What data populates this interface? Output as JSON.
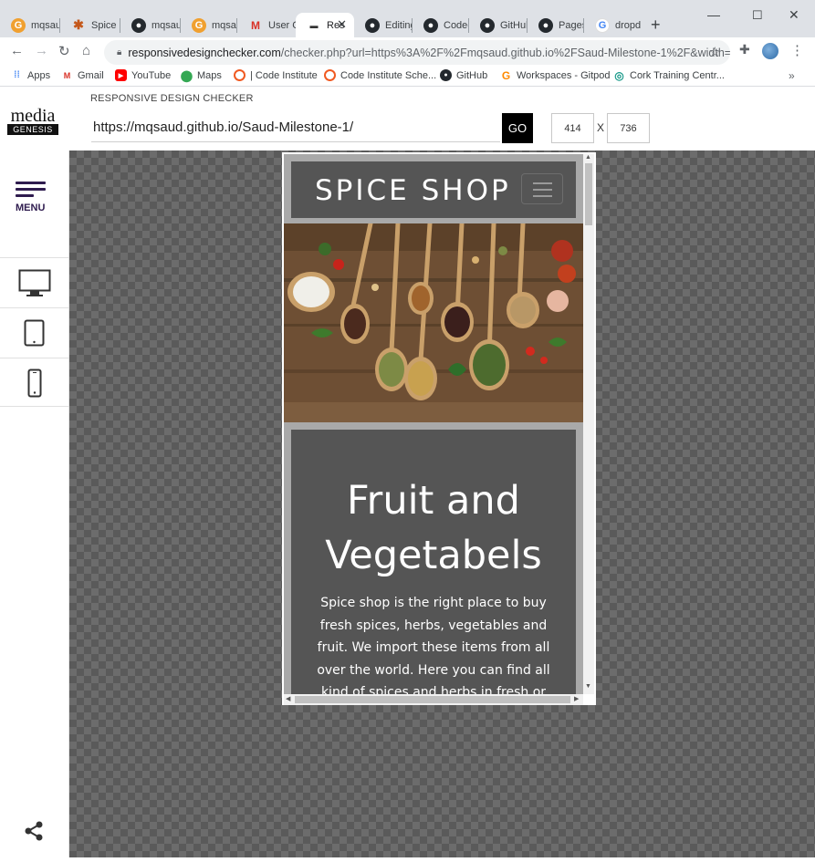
{
  "browser": {
    "tabs": [
      {
        "title": "mqsau",
        "icon": "g-orange-icon"
      },
      {
        "title": "Spice S",
        "icon": "spice-icon"
      },
      {
        "title": "mqsau",
        "icon": "github-icon"
      },
      {
        "title": "mqsau",
        "icon": "g-orange-icon"
      },
      {
        "title": "User C",
        "icon": "gmail-icon"
      },
      {
        "title": "Res",
        "icon": "rdc-icon",
        "active": true
      },
      {
        "title": "Editing",
        "icon": "github-icon"
      },
      {
        "title": "Code-",
        "icon": "github-icon"
      },
      {
        "title": "GitHub",
        "icon": "github-icon"
      },
      {
        "title": "Pages",
        "icon": "github-icon"
      },
      {
        "title": "dropd",
        "icon": "google-icon"
      }
    ],
    "address": {
      "host": "responsivedesignchecker.com",
      "path": "/checker.php?url=https%3A%2F%2Fmqsaud.github.io%2FSaud-Milestone-1%2F&width=1..."
    },
    "bookmarks": [
      {
        "label": "Apps",
        "icon": "apps-grid-icon"
      },
      {
        "label": "Gmail",
        "icon": "gmail-icon"
      },
      {
        "label": "YouTube",
        "icon": "youtube-icon"
      },
      {
        "label": "Maps",
        "icon": "maps-icon"
      },
      {
        "label": "| Code Institute",
        "icon": "code-institute-icon"
      },
      {
        "label": "Code Institute Sche...",
        "icon": "code-institute-icon"
      },
      {
        "label": "GitHub",
        "icon": "github-icon"
      },
      {
        "label": "Workspaces - Gitpod",
        "icon": "gitpod-icon"
      },
      {
        "label": "Cork Training Centr...",
        "icon": "cork-training-icon"
      }
    ],
    "bookmarks_more": "»"
  },
  "checker": {
    "header_label": "RESPONSIVE DESIGN CHECKER",
    "logo_top": "media",
    "logo_bottom": "GENESIS",
    "url_value": "https://mqsaud.github.io/Saud-Milestone-1/",
    "go_label": "GO",
    "width_value": "414",
    "height_value": "736",
    "dim_separator": "X",
    "menu_label": "MENU"
  },
  "site": {
    "brand": "SPICE SHOP",
    "card_title": "Fruit and Vegetabels",
    "card_text": "Spice shop is the right place to buy fresh spices, herbs, vegetables and fruit. We import these items from all over the world. Here you can find all kind of spices and herbs in fresh or"
  },
  "colors": {
    "site_panel": "#555555",
    "site_background": "#a9a9a9",
    "menu_accent": "#2e1b4e",
    "go_button": "#000000"
  }
}
